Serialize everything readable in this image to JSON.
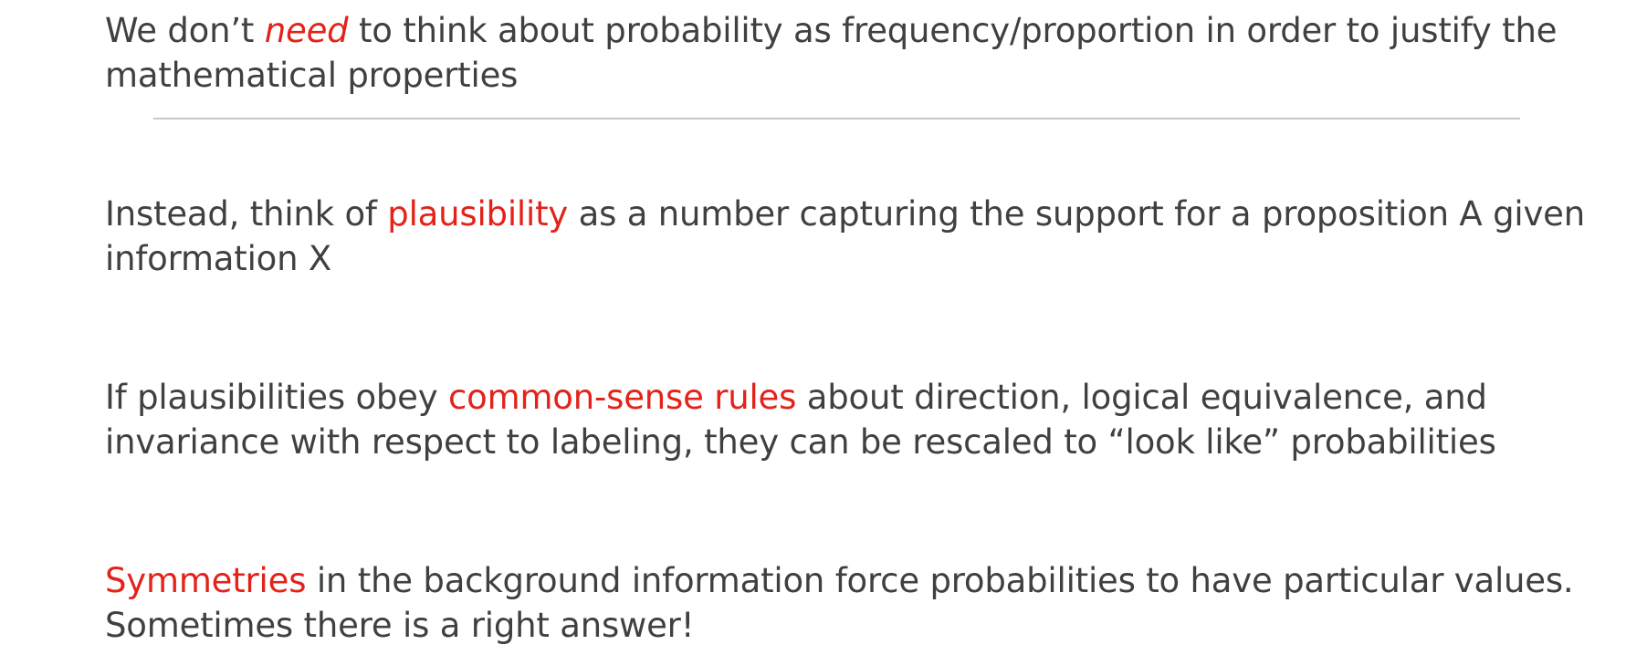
{
  "slide": {
    "paragraphs": [
      {
        "before": "We don’t ",
        "highlight": "need",
        "after": " to think about probability as frequency/proportion in order to justify the mathematical properties"
      },
      {
        "before": "Instead, think of ",
        "highlight": "plausibility",
        "after": " as a number capturing the support for a proposition A given information X"
      },
      {
        "before": "If plausibilities obey ",
        "highlight": "common-sense rules",
        "after": " about direction, logical equivalence, and invariance with respect to labeling, they can be rescaled to “look like” probabilities"
      },
      {
        "before": "",
        "highlight": "Symmetries",
        "after": " in the background information force probabilities to have particular values. Sometimes there is a right answer!"
      }
    ]
  },
  "colors": {
    "body_text": "#404040",
    "highlight": "#e3231a",
    "rule": "#c8c8c8"
  }
}
